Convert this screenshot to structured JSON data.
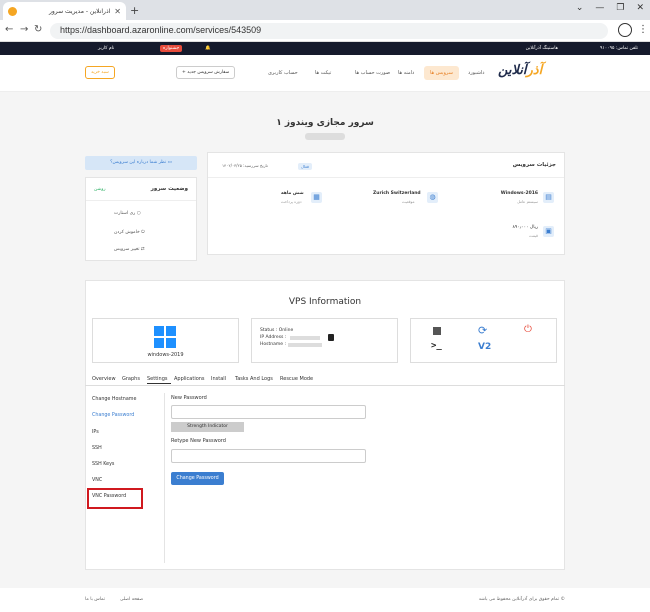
{
  "browser": {
    "tab_title": "آذرآنلاین - مدیریت سرور",
    "url": "https://dashboard.azaronline.com/services/543509"
  },
  "topbar": {
    "phone": "تلفن تماس: ۹۱۰۰۹۵",
    "hosting": "هاستینگ آذرآنلاین",
    "promo": "جشنواره",
    "account": "نام کاربر"
  },
  "nav": {
    "logo_a": "آذر",
    "logo_b": "آنلاین",
    "dashboard": "داشبورد",
    "services": "سرویس ها",
    "domains": "دامنه ها",
    "invoices": "صورت حساب ها",
    "tickets": "تیکت ها",
    "affiliate": "حساب کاربری",
    "order_btn": "+ سفارش سرویس جدید",
    "cart_btn": "سبد خرید"
  },
  "page": {
    "title": "۱ سرور مجازی ویندوز"
  },
  "sidebar": {
    "help": "نظر شما درباره این سرویس؟",
    "status_title": "وضعیت سرور",
    "status_value": "روشن",
    "restart": "ری استارت",
    "shutdown": "خاموش کردن",
    "change_service": "تغییر سرویس"
  },
  "service": {
    "title": "جزئیات سرویس",
    "status_badge": "فعال",
    "date": "تاریخ سررسید: ۱۴۰۲/۰۳/۲۵",
    "os": "Windows-2016",
    "os_sub": "سیستم عامل",
    "location": "Zurich Switzerland",
    "location_sub": "موقعیت",
    "period": "شش ماهه",
    "period_sub": "دوره پرداخت",
    "price": "۸۹۰٫۰۰۰ ریال",
    "price_sub": "قیمت"
  },
  "vps": {
    "title": "VPS Information",
    "os_label": "windows-2019",
    "status_line": "Status : Online",
    "ip_label": "IP Address :",
    "host_label": "Hostname :"
  },
  "tabs": [
    "Overview",
    "Graphs",
    "Settings",
    "Applications",
    "Install",
    "Tasks And Logs",
    "Rescue Mode"
  ],
  "side_menu": [
    "Change Hostname",
    "Change Password",
    "IPs",
    "SSH",
    "SSH Keys",
    "VNC",
    "VNC Password"
  ],
  "form": {
    "new_pw": "New Password",
    "strength": "Strength Indicator",
    "retype": "Retype New Password",
    "submit": "Change Password"
  },
  "footer": {
    "copyright": "© تمام حقوق برای آذرآنلاین محفوظ می باشد",
    "link1": "صفحه اصلی",
    "link2": "تماس با ما"
  }
}
